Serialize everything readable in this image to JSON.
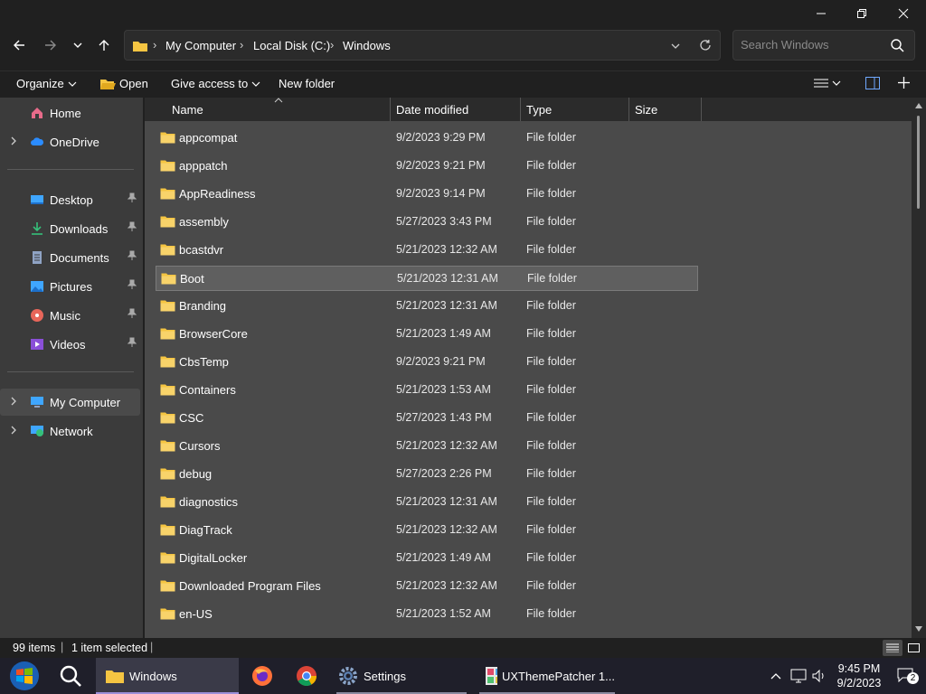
{
  "window": {
    "minimize_label": "—",
    "restore_label": "❐",
    "close_label": "✕"
  },
  "address": {
    "crumbs": [
      "My Computer",
      "Local Disk (C:)",
      "Windows"
    ],
    "search_placeholder": "Search Windows"
  },
  "commands": {
    "organize": "Organize",
    "open": "Open",
    "give_access": "Give access to",
    "new_folder": "New folder"
  },
  "sidebar": {
    "items": [
      {
        "label": "Home",
        "icon": "home-icon"
      },
      {
        "label": "OneDrive",
        "icon": "cloud-icon"
      },
      {
        "label": "Desktop",
        "icon": "desktop-icon"
      },
      {
        "label": "Downloads",
        "icon": "download-icon"
      },
      {
        "label": "Documents",
        "icon": "document-icon"
      },
      {
        "label": "Pictures",
        "icon": "picture-icon"
      },
      {
        "label": "Music",
        "icon": "music-icon"
      },
      {
        "label": "Videos",
        "icon": "video-icon"
      },
      {
        "label": "My Computer",
        "icon": "computer-icon"
      },
      {
        "label": "Network",
        "icon": "network-icon"
      }
    ]
  },
  "columns": {
    "name": "Name",
    "date": "Date modified",
    "type": "Type",
    "size": "Size"
  },
  "files": [
    {
      "name": "appcompat",
      "date": "9/2/2023 9:29 PM",
      "type": "File folder"
    },
    {
      "name": "apppatch",
      "date": "9/2/2023 9:21 PM",
      "type": "File folder"
    },
    {
      "name": "AppReadiness",
      "date": "9/2/2023 9:14 PM",
      "type": "File folder"
    },
    {
      "name": "assembly",
      "date": "5/27/2023 3:43 PM",
      "type": "File folder"
    },
    {
      "name": "bcastdvr",
      "date": "5/21/2023 12:32 AM",
      "type": "File folder"
    },
    {
      "name": "Boot",
      "date": "5/21/2023 12:31 AM",
      "type": "File folder",
      "selected": true
    },
    {
      "name": "Branding",
      "date": "5/21/2023 12:31 AM",
      "type": "File folder"
    },
    {
      "name": "BrowserCore",
      "date": "5/21/2023 1:49 AM",
      "type": "File folder"
    },
    {
      "name": "CbsTemp",
      "date": "9/2/2023 9:21 PM",
      "type": "File folder"
    },
    {
      "name": "Containers",
      "date": "5/21/2023 1:53 AM",
      "type": "File folder"
    },
    {
      "name": "CSC",
      "date": "5/27/2023 1:43 PM",
      "type": "File folder"
    },
    {
      "name": "Cursors",
      "date": "5/21/2023 12:32 AM",
      "type": "File folder"
    },
    {
      "name": "debug",
      "date": "5/27/2023 2:26 PM",
      "type": "File folder"
    },
    {
      "name": "diagnostics",
      "date": "5/21/2023 12:31 AM",
      "type": "File folder"
    },
    {
      "name": "DiagTrack",
      "date": "5/21/2023 12:32 AM",
      "type": "File folder"
    },
    {
      "name": "DigitalLocker",
      "date": "5/21/2023 1:49 AM",
      "type": "File folder"
    },
    {
      "name": "Downloaded Program Files",
      "date": "5/21/2023 12:32 AM",
      "type": "File folder"
    },
    {
      "name": "en-US",
      "date": "5/21/2023 1:52 AM",
      "type": "File folder"
    }
  ],
  "status": {
    "items": "99 items",
    "selected": "1 item selected"
  },
  "taskbar": {
    "apps": [
      {
        "label": "Windows",
        "icon": "folder-icon"
      },
      {
        "label": "",
        "icon": "firefox-icon"
      },
      {
        "label": "",
        "icon": "chrome-icon"
      },
      {
        "label": "Settings",
        "icon": "settings-icon"
      },
      {
        "label": "UXThemePatcher 1...",
        "icon": "patcher-icon"
      }
    ],
    "time": "9:45 PM",
    "date": "9/2/2023",
    "notifications": "2"
  },
  "colors": {
    "accent": "#9a8fd8",
    "folder": "#f5c542",
    "selected_row": "#5f5f5f"
  }
}
